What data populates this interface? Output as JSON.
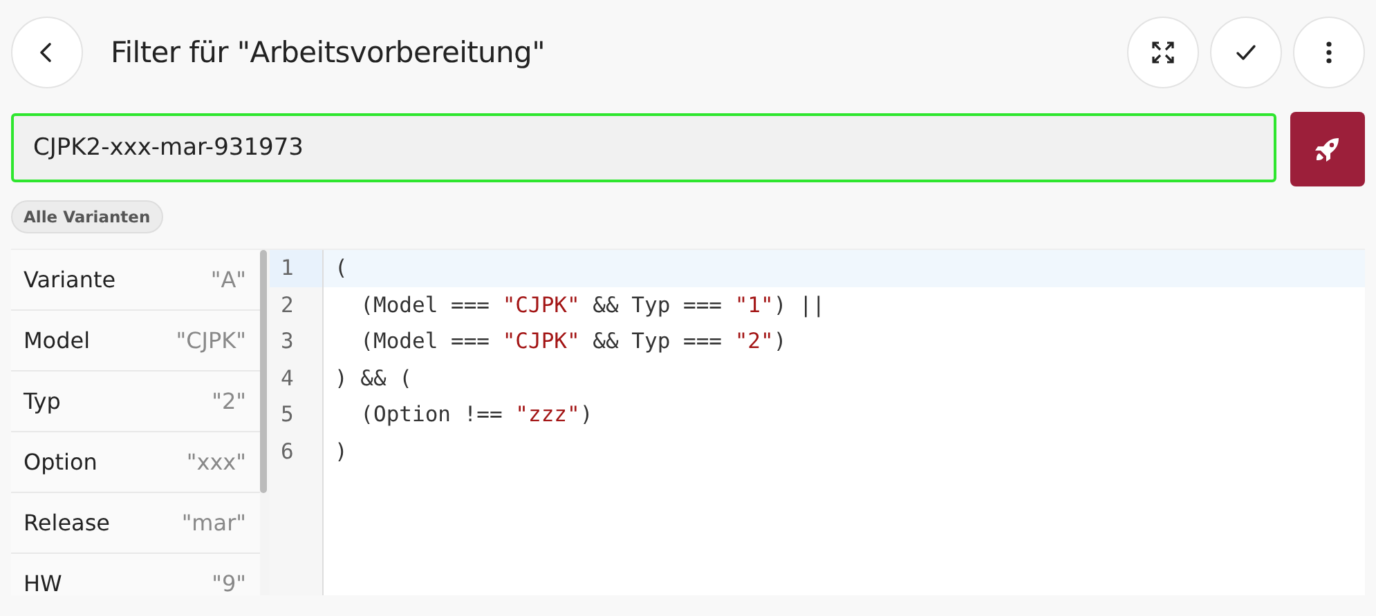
{
  "header": {
    "title": "Filter für \"Arbeitsvorbereitung\""
  },
  "search": {
    "value": "CJPK2-xxx-mar-931973",
    "focused": true
  },
  "chips": [
    {
      "label": "Alle Varianten"
    }
  ],
  "variables": [
    {
      "name": "Variante",
      "value": "\"A\""
    },
    {
      "name": "Model",
      "value": "\"CJPK\""
    },
    {
      "name": "Typ",
      "value": "\"2\""
    },
    {
      "name": "Option",
      "value": "\"xxx\""
    },
    {
      "name": "Release",
      "value": "\"mar\""
    },
    {
      "name": "HW",
      "value": "\"9\""
    }
  ],
  "editor": {
    "lines": [
      {
        "number": "1",
        "active": true,
        "tokens": [
          {
            "kind": "plain",
            "text": "("
          }
        ]
      },
      {
        "number": "2",
        "active": false,
        "tokens": [
          {
            "kind": "plain",
            "text": "  (Model === "
          },
          {
            "kind": "string",
            "text": "\"CJPK\""
          },
          {
            "kind": "plain",
            "text": " && Typ === "
          },
          {
            "kind": "string",
            "text": "\"1\""
          },
          {
            "kind": "plain",
            "text": ") ||"
          }
        ]
      },
      {
        "number": "3",
        "active": false,
        "tokens": [
          {
            "kind": "plain",
            "text": "  (Model === "
          },
          {
            "kind": "string",
            "text": "\"CJPK\""
          },
          {
            "kind": "plain",
            "text": " && Typ === "
          },
          {
            "kind": "string",
            "text": "\"2\""
          },
          {
            "kind": "plain",
            "text": ")"
          }
        ]
      },
      {
        "number": "4",
        "active": false,
        "tokens": [
          {
            "kind": "plain",
            "text": ") && ("
          }
        ]
      },
      {
        "number": "5",
        "active": false,
        "tokens": [
          {
            "kind": "plain",
            "text": "  (Option !== "
          },
          {
            "kind": "string",
            "text": "\"zzz\""
          },
          {
            "kind": "plain",
            "text": ")"
          }
        ]
      },
      {
        "number": "6",
        "active": false,
        "tokens": [
          {
            "kind": "plain",
            "text": ")"
          }
        ]
      }
    ]
  }
}
